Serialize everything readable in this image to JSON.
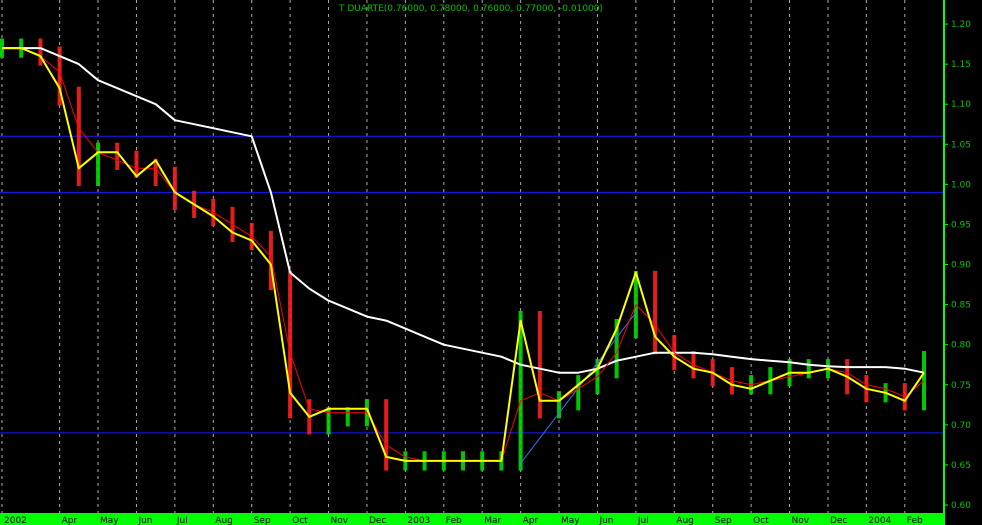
{
  "chart_data": {
    "type": "line",
    "title": "T DUARTE(0.76000, 0.78000, 0.76000, 0.77000, -0.01000)",
    "ylim": [
      0.59,
      1.23
    ],
    "y_ticks": [
      1.2,
      1.15,
      1.1,
      1.05,
      1.0,
      0.95,
      0.9,
      0.85,
      0.8,
      0.75,
      0.7,
      0.65,
      0.6
    ],
    "y_tick_labels": [
      "1.20",
      "1.15",
      "1.10",
      "1.05",
      "1.00",
      "0.95",
      "0.90",
      "0.85",
      "0.80",
      "0.75",
      "0.70",
      "0.65",
      "0.60"
    ],
    "x_tick_labels": [
      "2002",
      "Apr",
      "May",
      "Jun",
      "Jul",
      "Aug",
      "Sep",
      "Oct",
      "Nov",
      "Dec",
      "2003",
      "Feb",
      "Mar",
      "Apr",
      "May",
      "Jun",
      "Jul",
      "Aug",
      "Sep",
      "Oct",
      "Nov",
      "Dec",
      "2004",
      "Feb"
    ],
    "x_tick_index": [
      0,
      3,
      5,
      7,
      9,
      11,
      13,
      15,
      17,
      19,
      21,
      23,
      25,
      27,
      29,
      31,
      33,
      35,
      37,
      39,
      41,
      43,
      45,
      47
    ],
    "x_count": 49,
    "grid": true,
    "horizontal_lines": [
      1.06,
      0.99,
      0.69
    ],
    "colors": {
      "background": "#000000",
      "grid": "#c8c8c8",
      "price_up": "#00dd00",
      "price_down": "#ff2020",
      "fast_average": "#ffff00",
      "slow_average": "#ffffff",
      "signal_average": "#ff0000",
      "horizontal_line": "#1818ff",
      "trendline": "#3070ff",
      "axis_strip": "#00ff00",
      "text": "#00c000"
    },
    "trendline": {
      "from": [
        27,
        0.652
      ],
      "to": [
        33,
        0.84
      ]
    },
    "series": [
      {
        "type": "close",
        "values": [
          1.17,
          1.17,
          1.16,
          1.11,
          1.01,
          1.04,
          1.03,
          1.02,
          1.01,
          0.98,
          0.97,
          0.96,
          0.94,
          0.93,
          0.88,
          0.72,
          0.7,
          0.71,
          0.71,
          0.72,
          0.655,
          0.655,
          0.655,
          0.655,
          0.655,
          0.655,
          0.655,
          0.83,
          0.72,
          0.73,
          0.75,
          0.77,
          0.82,
          0.88,
          0.8,
          0.78,
          0.77,
          0.76,
          0.75,
          0.75,
          0.76,
          0.77,
          0.77,
          0.77,
          0.75,
          0.74,
          0.74,
          0.73,
          0.78
        ]
      },
      {
        "type": "fast_average",
        "values": [
          1.17,
          1.17,
          1.16,
          1.12,
          1.02,
          1.04,
          1.04,
          1.01,
          1.03,
          0.99,
          0.975,
          0.96,
          0.94,
          0.93,
          0.9,
          0.74,
          0.71,
          0.72,
          0.72,
          0.72,
          0.66,
          0.655,
          0.655,
          0.655,
          0.655,
          0.655,
          0.655,
          0.83,
          0.73,
          0.73,
          0.75,
          0.77,
          0.82,
          0.89,
          0.81,
          0.785,
          0.77,
          0.765,
          0.75,
          0.745,
          0.755,
          0.765,
          0.765,
          0.77,
          0.76,
          0.745,
          0.74,
          0.73,
          0.765
        ]
      },
      {
        "type": "signal_average",
        "values": [
          1.17,
          1.17,
          1.16,
          1.14,
          1.07,
          1.04,
          1.03,
          1.02,
          1.02,
          0.99,
          0.975,
          0.965,
          0.95,
          0.935,
          0.91,
          0.79,
          0.72,
          0.715,
          0.715,
          0.715,
          0.675,
          0.66,
          0.655,
          0.655,
          0.655,
          0.655,
          0.655,
          0.73,
          0.74,
          0.73,
          0.745,
          0.76,
          0.79,
          0.85,
          0.825,
          0.79,
          0.775,
          0.765,
          0.755,
          0.75,
          0.755,
          0.76,
          0.765,
          0.77,
          0.765,
          0.75,
          0.745,
          0.735,
          0.755
        ]
      },
      {
        "type": "slow_average",
        "values": [
          1.17,
          1.17,
          1.17,
          1.16,
          1.15,
          1.13,
          1.12,
          1.11,
          1.1,
          1.08,
          1.075,
          1.07,
          1.065,
          1.06,
          0.99,
          0.89,
          0.87,
          0.855,
          0.845,
          0.835,
          0.83,
          0.82,
          0.81,
          0.8,
          0.795,
          0.79,
          0.785,
          0.775,
          0.77,
          0.765,
          0.765,
          0.77,
          0.78,
          0.785,
          0.79,
          0.79,
          0.79,
          0.788,
          0.785,
          0.782,
          0.78,
          0.778,
          0.775,
          0.773,
          0.772,
          0.772,
          0.772,
          0.77,
          0.765
        ]
      }
    ]
  }
}
